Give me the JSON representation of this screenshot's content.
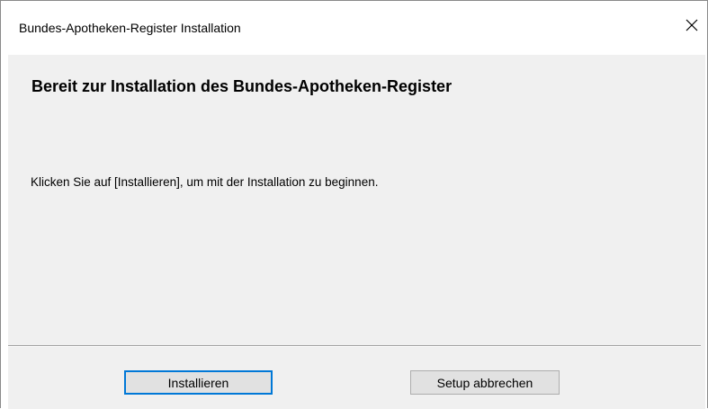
{
  "window": {
    "title": "Bundes-Apotheken-Register Installation"
  },
  "content": {
    "heading": "Bereit zur Installation des Bundes-Apotheken-Register",
    "message": "Klicken Sie auf [Installieren], um mit der Installation zu beginnen."
  },
  "buttons": {
    "install_label": "Installieren",
    "cancel_label": "Setup abbrechen"
  },
  "icons": {
    "close": "close-icon"
  },
  "colors": {
    "client_background": "#f0f0f0",
    "default_button_border": "#0078d7",
    "button_background": "#e1e1e1"
  }
}
